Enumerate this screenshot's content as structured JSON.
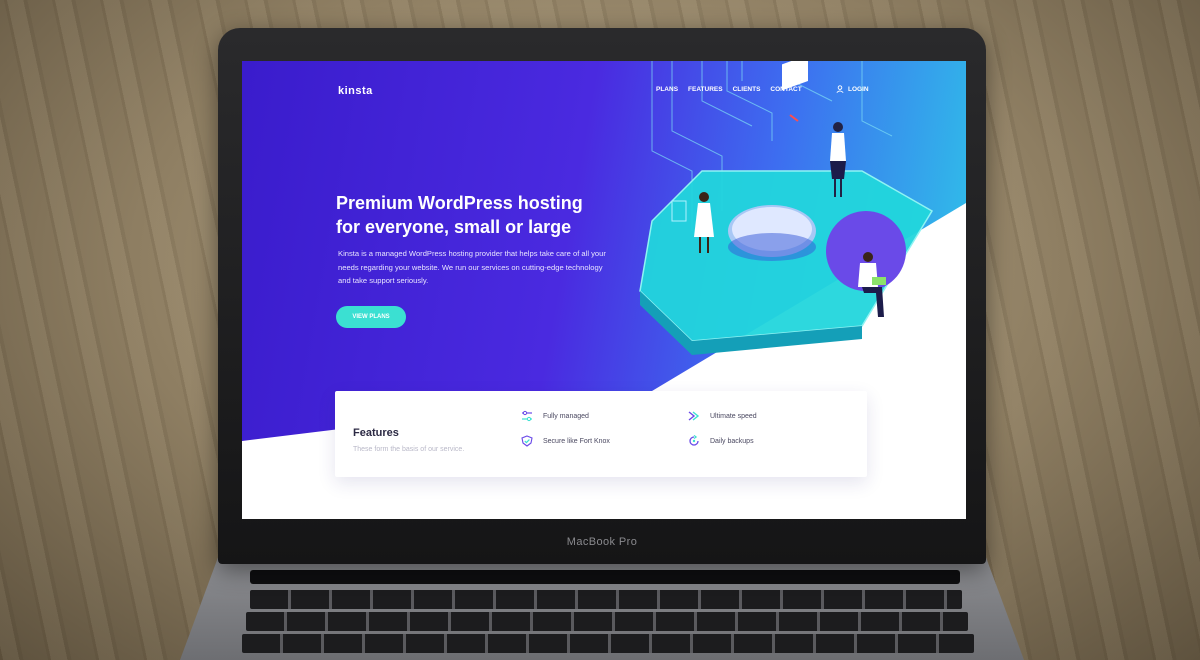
{
  "device": {
    "brand_label": "MacBook Pro"
  },
  "nav": {
    "logo": "kinsta",
    "links": [
      "PLANS",
      "FEATURES",
      "CLIENTS",
      "CONTACT"
    ],
    "login": "LOGIN"
  },
  "hero": {
    "title_line1": "Premium WordPress hosting",
    "title_line2": "for everyone, small or large",
    "description": "Kinsta is a managed WordPress hosting provider that helps take care of all your needs regarding your website. We run our services on cutting-edge technology and take support seriously.",
    "cta_label": "VIEW PLANS"
  },
  "features": {
    "title": "Features",
    "subtitle": "These form the basis of our service.",
    "items": [
      {
        "label": "Fully managed",
        "icon": "sliders-icon"
      },
      {
        "label": "Ultimate speed",
        "icon": "fast-forward-icon"
      },
      {
        "label": "Secure like Fort Knox",
        "icon": "shield-check-icon"
      },
      {
        "label": "Daily backups",
        "icon": "backup-icon"
      }
    ]
  },
  "colors": {
    "hero_start": "#3a1ccc",
    "hero_end": "#2ec8e8",
    "accent": "#3be0d2"
  }
}
